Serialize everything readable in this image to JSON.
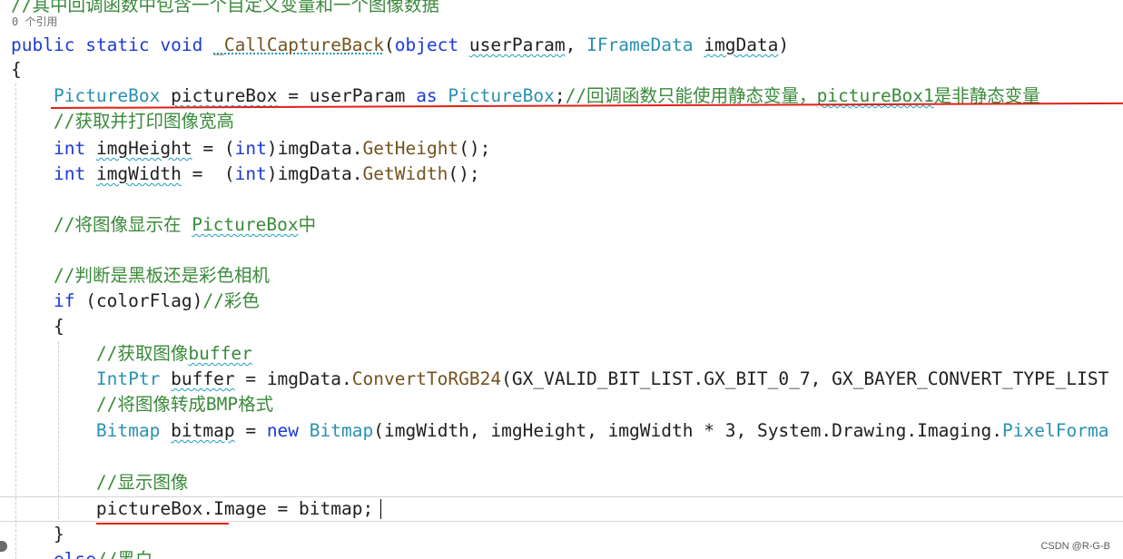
{
  "editor": {
    "codelens_text": "0 个引用",
    "lines": [
      {
        "tokens": [
          {
            "t": "//其中回调函数中包含一个自定义变量和一个图像数据",
            "c": "cm"
          }
        ]
      },
      {
        "tokens": [
          {
            "t": "public",
            "c": "kw"
          },
          {
            "t": " ",
            "c": "pr"
          },
          {
            "t": "static",
            "c": "kw"
          },
          {
            "t": " ",
            "c": "pr"
          },
          {
            "t": "void",
            "c": "kw"
          },
          {
            "t": " ",
            "c": "pr"
          },
          {
            "t": "_CallCaptureBack",
            "c": "fn",
            "u": "dot"
          },
          {
            "t": "(",
            "c": "pr"
          },
          {
            "t": "object",
            "c": "kw"
          },
          {
            "t": " ",
            "c": "pr"
          },
          {
            "t": "userParam",
            "c": "id",
            "u": "wavy"
          },
          {
            "t": ", ",
            "c": "pr"
          },
          {
            "t": "IFrameData",
            "c": "tp"
          },
          {
            "t": " ",
            "c": "pr"
          },
          {
            "t": "imgData",
            "c": "id",
            "u": "wavy"
          },
          {
            "t": ")",
            "c": "pr"
          }
        ]
      },
      {
        "tokens": [
          {
            "t": "{",
            "c": "pr"
          }
        ]
      },
      {
        "tokens": [
          {
            "t": "    ",
            "c": "pr"
          },
          {
            "t": "PictureBox",
            "c": "tp"
          },
          {
            "t": " ",
            "c": "pr"
          },
          {
            "t": "pictureBox",
            "c": "id",
            "u": "wavy"
          },
          {
            "t": " = ",
            "c": "pr"
          },
          {
            "t": "userParam",
            "c": "id"
          },
          {
            "t": " ",
            "c": "pr"
          },
          {
            "t": "as",
            "c": "kw"
          },
          {
            "t": " ",
            "c": "pr"
          },
          {
            "t": "PictureBox",
            "c": "tp"
          },
          {
            "t": ";",
            "c": "pr"
          },
          {
            "t": "//回调函数只能使用静态变量，",
            "c": "cm"
          },
          {
            "t": "pictureBox1",
            "c": "cm",
            "u": "wavy"
          },
          {
            "t": "是非静态变量",
            "c": "cm"
          }
        ]
      },
      {
        "tokens": [
          {
            "t": "    ",
            "c": "pr"
          },
          {
            "t": "//获取并打印图像宽高",
            "c": "cm"
          }
        ]
      },
      {
        "tokens": [
          {
            "t": "    ",
            "c": "pr"
          },
          {
            "t": "int",
            "c": "kw"
          },
          {
            "t": " ",
            "c": "pr"
          },
          {
            "t": "imgHeight",
            "c": "id",
            "u": "wavy"
          },
          {
            "t": " = (",
            "c": "pr"
          },
          {
            "t": "int",
            "c": "kw"
          },
          {
            "t": ")",
            "c": "pr"
          },
          {
            "t": "imgData",
            "c": "id"
          },
          {
            "t": ".",
            "c": "pr"
          },
          {
            "t": "GetHeight",
            "c": "fn"
          },
          {
            "t": "();",
            "c": "pr"
          }
        ]
      },
      {
        "tokens": [
          {
            "t": "    ",
            "c": "pr"
          },
          {
            "t": "int",
            "c": "kw"
          },
          {
            "t": " ",
            "c": "pr"
          },
          {
            "t": "imgWidth",
            "c": "id",
            "u": "wavy"
          },
          {
            "t": " =  (",
            "c": "pr"
          },
          {
            "t": "int",
            "c": "kw"
          },
          {
            "t": ")",
            "c": "pr"
          },
          {
            "t": "imgData",
            "c": "id"
          },
          {
            "t": ".",
            "c": "pr"
          },
          {
            "t": "GetWidth",
            "c": "fn"
          },
          {
            "t": "();",
            "c": "pr"
          }
        ]
      },
      {
        "tokens": []
      },
      {
        "tokens": [
          {
            "t": "    ",
            "c": "pr"
          },
          {
            "t": "//将图像显示在 ",
            "c": "cm"
          },
          {
            "t": "PictureBox",
            "c": "cm",
            "u": "wavy"
          },
          {
            "t": "中",
            "c": "cm"
          }
        ]
      },
      {
        "tokens": []
      },
      {
        "tokens": [
          {
            "t": "    ",
            "c": "pr"
          },
          {
            "t": "//判断是黑板还是彩色相机",
            "c": "cm"
          }
        ]
      },
      {
        "tokens": [
          {
            "t": "    ",
            "c": "pr"
          },
          {
            "t": "if",
            "c": "kw"
          },
          {
            "t": " (",
            "c": "pr"
          },
          {
            "t": "colorFlag",
            "c": "id"
          },
          {
            "t": ")",
            "c": "pr"
          },
          {
            "t": "//彩色",
            "c": "cm"
          }
        ]
      },
      {
        "tokens": [
          {
            "t": "    ",
            "c": "pr"
          },
          {
            "t": "{",
            "c": "pr"
          }
        ]
      },
      {
        "tokens": [
          {
            "t": "        ",
            "c": "pr"
          },
          {
            "t": "//获取图像",
            "c": "cm"
          },
          {
            "t": "buffer",
            "c": "cm",
            "u": "wavy"
          }
        ]
      },
      {
        "tokens": [
          {
            "t": "        ",
            "c": "pr"
          },
          {
            "t": "IntPtr",
            "c": "tp"
          },
          {
            "t": " ",
            "c": "pr"
          },
          {
            "t": "buffer",
            "c": "id",
            "u": "wavy"
          },
          {
            "t": " = ",
            "c": "pr"
          },
          {
            "t": "imgData",
            "c": "id"
          },
          {
            "t": ".",
            "c": "pr"
          },
          {
            "t": "ConvertToRGB24",
            "c": "fn"
          },
          {
            "t": "(",
            "c": "pr"
          },
          {
            "t": "GX_VALID_BIT_LIST",
            "c": "id"
          },
          {
            "t": ".",
            "c": "pr"
          },
          {
            "t": "GX_BIT_0_7",
            "c": "id"
          },
          {
            "t": ", ",
            "c": "pr"
          },
          {
            "t": "GX_BAYER_CONVERT_TYPE_LIST",
            "c": "id"
          }
        ]
      },
      {
        "tokens": [
          {
            "t": "        ",
            "c": "pr"
          },
          {
            "t": "//将图像转成BMP格式",
            "c": "cm"
          }
        ]
      },
      {
        "tokens": [
          {
            "t": "        ",
            "c": "pr"
          },
          {
            "t": "Bitmap",
            "c": "tp"
          },
          {
            "t": " ",
            "c": "pr"
          },
          {
            "t": "bitmap",
            "c": "id",
            "u": "wavy"
          },
          {
            "t": " = ",
            "c": "pr"
          },
          {
            "t": "new",
            "c": "kw"
          },
          {
            "t": " ",
            "c": "pr"
          },
          {
            "t": "Bitmap",
            "c": "tp"
          },
          {
            "t": "(",
            "c": "pr"
          },
          {
            "t": "imgWidth",
            "c": "id"
          },
          {
            "t": ", ",
            "c": "pr"
          },
          {
            "t": "imgHeight",
            "c": "id"
          },
          {
            "t": ", ",
            "c": "pr"
          },
          {
            "t": "imgWidth",
            "c": "id"
          },
          {
            "t": " * ",
            "c": "pr"
          },
          {
            "t": "3",
            "c": "pr"
          },
          {
            "t": ", ",
            "c": "pr"
          },
          {
            "t": "System",
            "c": "id"
          },
          {
            "t": ".",
            "c": "pr"
          },
          {
            "t": "Drawing",
            "c": "id"
          },
          {
            "t": ".",
            "c": "pr"
          },
          {
            "t": "Imaging",
            "c": "id"
          },
          {
            "t": ".",
            "c": "pr"
          },
          {
            "t": "PixelForma",
            "c": "tp"
          }
        ]
      },
      {
        "tokens": []
      },
      {
        "tokens": [
          {
            "t": "        ",
            "c": "pr"
          },
          {
            "t": "//显示图像",
            "c": "cm"
          }
        ]
      },
      {
        "tokens": [
          {
            "t": "        ",
            "c": "pr"
          },
          {
            "t": "pictureBox",
            "c": "id"
          },
          {
            "t": ".",
            "c": "pr"
          },
          {
            "t": "Image",
            "c": "id"
          },
          {
            "t": " = ",
            "c": "pr"
          },
          {
            "t": "bitmap",
            "c": "id"
          },
          {
            "t": ";",
            "c": "pr"
          }
        ]
      },
      {
        "tokens": [
          {
            "t": "    ",
            "c": "pr"
          },
          {
            "t": "}",
            "c": "pr"
          }
        ]
      },
      {
        "tokens": [
          {
            "t": "    ",
            "c": "pr"
          },
          {
            "t": "else",
            "c": "kw"
          },
          {
            "t": "//黑白",
            "c": "cm"
          }
        ]
      }
    ]
  },
  "colors": {
    "keyword": "#1b3bd6",
    "type": "#2b91af",
    "method": "#74531f",
    "comment": "#3a8a3a",
    "annotation_red": "#e0201c"
  },
  "watermark": "CSDN @R-G-B"
}
